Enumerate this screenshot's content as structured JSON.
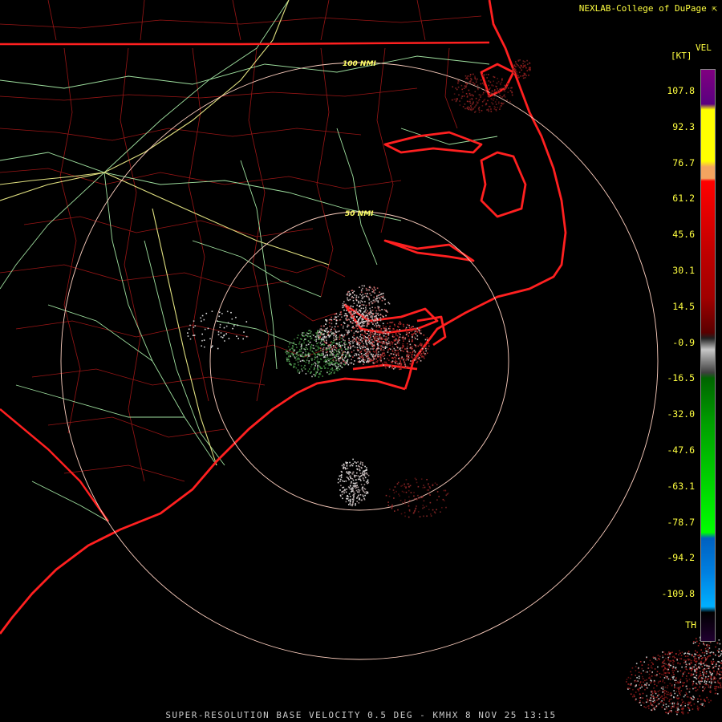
{
  "header": {
    "credit": "NEXLAB-College of DuPage",
    "credit_icon": "cursor-arrow-icon"
  },
  "product": {
    "title": "SUPER-RESOLUTION BASE VELOCITY 0.5 DEG - KMHX 8 NOV 25 13:15",
    "station": "KMHX"
  },
  "legend": {
    "title": "VEL",
    "unit": "[KT]",
    "ticks": [
      "107.8",
      "92.3",
      "76.7",
      "61.2",
      "45.6",
      "30.1",
      "14.5",
      "-0.9",
      "-16.5",
      "-32.0",
      "-47.6",
      "-63.1",
      "-78.7",
      "-94.2",
      "-109.8",
      "TH"
    ],
    "colors": {
      "purple": "#800080",
      "yellow": "#ffff00",
      "orange": "#f4a460",
      "red": "#ff0000",
      "dark_red": "#5a0000",
      "gray": "#c8c8c8",
      "dark_green": "#006400",
      "green": "#00ff00",
      "blue": "#0060c0",
      "cyan": "#00b0ff"
    }
  },
  "range_rings": [
    {
      "label": "50 NMI",
      "nmi": 50
    },
    {
      "label": "100 NMI",
      "nmi": 100
    }
  ],
  "map_colors": {
    "background": "#000000",
    "state_border": "#ff2020",
    "coastline": "#ff2020",
    "county": "#a01818",
    "highway": "#a0e0a0",
    "interstate": "#e0e080",
    "ring": "#ffd0c0"
  }
}
